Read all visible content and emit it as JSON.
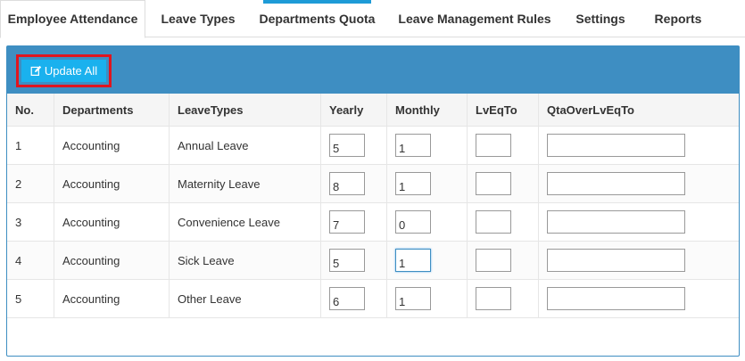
{
  "tabs": [
    {
      "label": "Employee Attendance",
      "active": true
    },
    {
      "label": "Leave Types",
      "active": false
    },
    {
      "label": "Departments Quota",
      "active": false
    },
    {
      "label": "Leave Management Rules",
      "active": false
    },
    {
      "label": "Settings",
      "active": false
    },
    {
      "label": "Reports",
      "active": false
    }
  ],
  "toolbar": {
    "update_all_label": "Update All",
    "icon": "edit-icon"
  },
  "table": {
    "columns": [
      "No.",
      "Departments",
      "LeaveTypes",
      "Yearly",
      "Monthly",
      "LvEqTo",
      "QtaOverLvEqTo"
    ],
    "rows": [
      {
        "no": "1",
        "department": "Accounting",
        "leave_type": "Annual Leave",
        "yearly": "5",
        "monthly": "1",
        "lveqto": "",
        "qtaoverlveqto": ""
      },
      {
        "no": "2",
        "department": "Accounting",
        "leave_type": "Maternity Leave",
        "yearly": "8",
        "monthly": "1",
        "lveqto": "",
        "qtaoverlveqto": ""
      },
      {
        "no": "3",
        "department": "Accounting",
        "leave_type": "Convenience Leave",
        "yearly": "7",
        "monthly": "0",
        "lveqto": "",
        "qtaoverlveqto": ""
      },
      {
        "no": "4",
        "department": "Accounting",
        "leave_type": "Sick Leave",
        "yearly": "5",
        "monthly": "1",
        "lveqto": "",
        "qtaoverlveqto": ""
      },
      {
        "no": "5",
        "department": "Accounting",
        "leave_type": "Other Leave",
        "yearly": "6",
        "monthly": "1",
        "lveqto": "",
        "qtaoverlveqto": ""
      }
    ]
  },
  "colors": {
    "panel_header": "#3e8ec2",
    "button": "#1ab1ee",
    "highlight": "#e0151f",
    "tab_indicator": "#1e9bd7"
  }
}
